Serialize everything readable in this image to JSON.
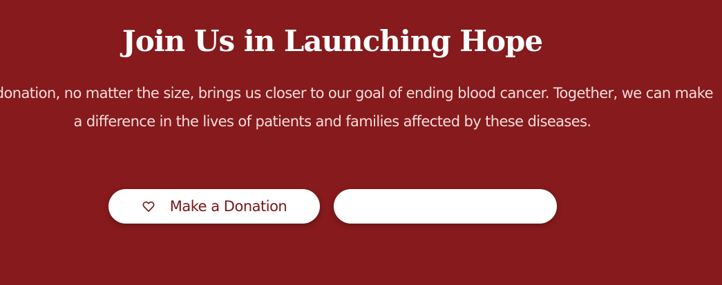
{
  "cta": {
    "title": "Join Us in Launching Hope",
    "description": "Every donation, no matter the size, brings us closer to our goal of ending blood cancer. Together, we can make a difference in the lives of patients and families affected by these diseases.",
    "donate_button": {
      "label": "Make a Donation",
      "icon": "heart-outline-icon"
    },
    "secondary_button": {
      "label": ""
    }
  },
  "colors": {
    "background": "#861a1c",
    "button_background": "#ffffff",
    "button_text": "#7a1417",
    "title_text": "#ffffff",
    "body_text": "#f6dcdc"
  }
}
